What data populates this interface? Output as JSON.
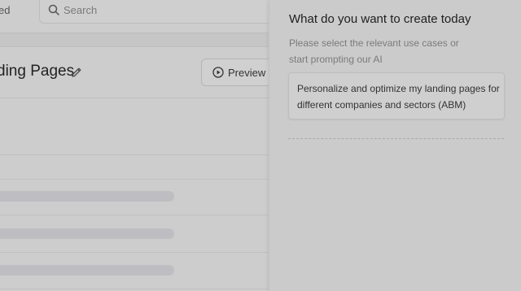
{
  "nav": {
    "truncated_label": "ed"
  },
  "search": {
    "placeholder": "Search"
  },
  "page": {
    "title": "ding Pages",
    "preview_label": "Preview"
  },
  "panel": {
    "title": "What do you want to create today",
    "subtitle": "Please select the relevant use cases or start prompting our AI",
    "use_cases": [
      {
        "label": "Personalize and optimize my landing pages for different companies and sectors (ABM)"
      }
    ]
  }
}
